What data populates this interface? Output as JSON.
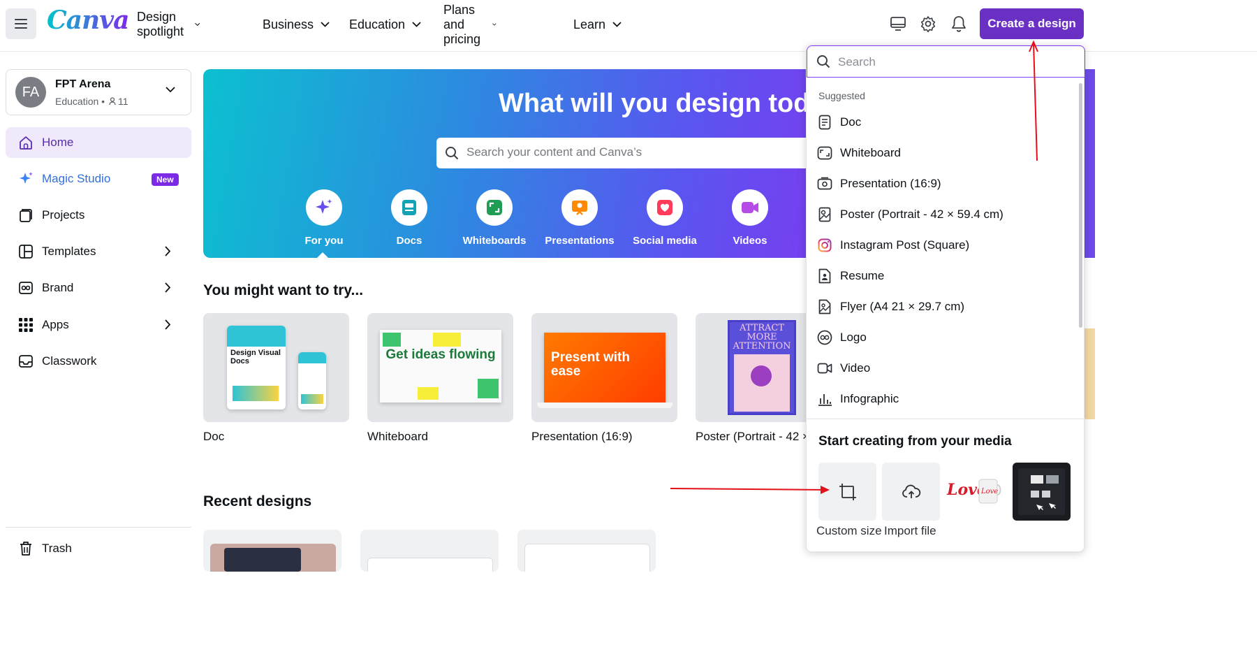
{
  "topbar": {
    "logo": "Canva",
    "nav": [
      {
        "label": "Design spotlight"
      },
      {
        "label": "Business"
      },
      {
        "label": "Education"
      },
      {
        "label": "Plans and pricing"
      },
      {
        "label": "Learn"
      }
    ],
    "create_button": "Create a design",
    "icons": [
      "desktop-icon",
      "gear-icon",
      "bell-icon"
    ]
  },
  "team": {
    "initials": "FA",
    "name": "FPT Arena",
    "subtitle": "Education • ",
    "members": "11"
  },
  "sidebar": {
    "items": [
      {
        "label": "Home",
        "icon": "home-icon",
        "active": true
      },
      {
        "label": "Magic Studio",
        "icon": "sparkle-icon",
        "badge": "New"
      },
      {
        "label": "Projects",
        "icon": "folder-icon"
      },
      {
        "label": "Templates",
        "icon": "template-icon"
      },
      {
        "label": "Brand",
        "icon": "brand-icon"
      },
      {
        "label": "Apps",
        "icon": "apps-icon"
      },
      {
        "label": "Classwork",
        "icon": "inbox-icon"
      }
    ],
    "trash": "Trash"
  },
  "hero": {
    "title": "What will you design today",
    "search_placeholder": "Search your content and Canva’s",
    "categories": [
      {
        "label": "For you",
        "color": "#6b4cf0"
      },
      {
        "label": "Docs",
        "color": "#13a3b5"
      },
      {
        "label": "Whiteboards",
        "color": "#1f9d55"
      },
      {
        "label": "Presentations",
        "color": "#ff8a00"
      },
      {
        "label": "Social media",
        "color": "#ff3b5b"
      },
      {
        "label": "Videos",
        "color": "#b64ce8"
      }
    ]
  },
  "try_section": {
    "title": "You might want to try...",
    "cards": [
      {
        "label": "Doc",
        "thumb_text": "Design Visual Docs"
      },
      {
        "label": "Whiteboard",
        "thumb_text": "Get ideas flowing"
      },
      {
        "label": "Presentation (16:9)",
        "thumb_text": "Present with ease"
      },
      {
        "label": "Poster (Portrait - 42 ×",
        "thumb_text": "ATTRACT MORE ATTENTION"
      }
    ]
  },
  "recent_section": {
    "title": "Recent designs"
  },
  "dropdown": {
    "search_placeholder": "Search",
    "suggested_label": "Suggested",
    "items": [
      {
        "label": "Doc",
        "icon": "doc-icon"
      },
      {
        "label": "Whiteboard",
        "icon": "whiteboard-icon"
      },
      {
        "label": "Presentation (16:9)",
        "icon": "presentation-icon"
      },
      {
        "label": "Poster (Portrait - 42 × 59.4 cm)",
        "icon": "poster-icon"
      },
      {
        "label": "Instagram Post (Square)",
        "icon": "instagram-icon"
      },
      {
        "label": "Resume",
        "icon": "resume-icon"
      },
      {
        "label": "Flyer (A4 21 × 29.7 cm)",
        "icon": "flyer-icon"
      },
      {
        "label": "Logo",
        "icon": "logo-icon"
      },
      {
        "label": "Video",
        "icon": "video-icon"
      },
      {
        "label": "Infographic",
        "icon": "chart-icon"
      }
    ],
    "media_title": "Start creating from your media",
    "media": [
      {
        "label": "Custom size"
      },
      {
        "label": "Import file"
      }
    ]
  }
}
